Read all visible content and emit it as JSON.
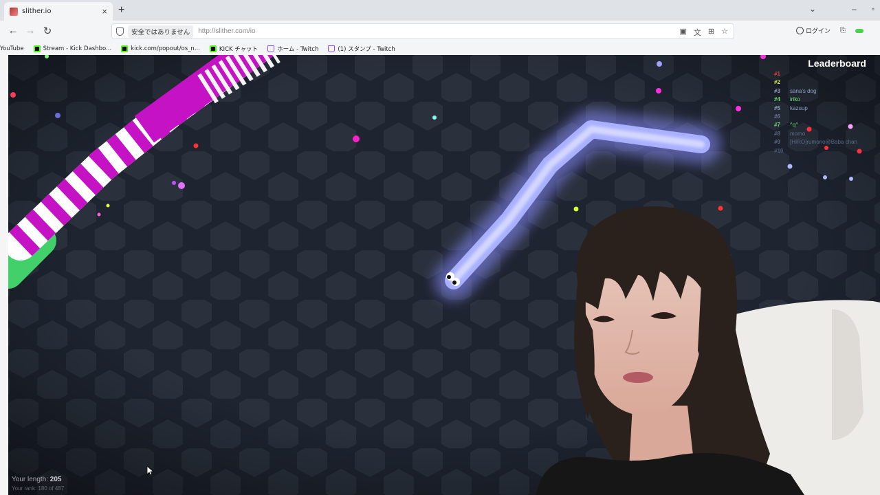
{
  "browser": {
    "tab_title": "slither.io",
    "new_tab": "+",
    "close_tab": "×",
    "insecure_label": "安全ではありません",
    "url": "http://slither.com/io",
    "login_label": "ログイン",
    "bookmarks": [
      {
        "label": "YouTube",
        "icon": "none"
      },
      {
        "label": "Stream - Kick Dashbo...",
        "icon": "kick"
      },
      {
        "label": "kick.com/popout/os_n...",
        "icon": "kick"
      },
      {
        "label": "KICK チャット",
        "icon": "kick"
      },
      {
        "label": "ホーム - Twitch",
        "icon": "twitch"
      },
      {
        "label": "(1) スタンプ - Twitch",
        "icon": "twitch"
      }
    ]
  },
  "game": {
    "leaderboard_title": "Leaderboard",
    "leaderboard": [
      {
        "rank": "#1",
        "name": "",
        "color": "#e04040"
      },
      {
        "rank": "#2",
        "name": "",
        "color": "#d4e84a"
      },
      {
        "rank": "#3",
        "name": "sana's dog",
        "color": "#8fa0c8"
      },
      {
        "rank": "#4",
        "name": "iriko",
        "color": "#6ee06e"
      },
      {
        "rank": "#5",
        "name": "kazuup",
        "color": "#8fa0c8"
      },
      {
        "rank": "#6",
        "name": "",
        "color": "#6a7a98"
      },
      {
        "rank": "#7",
        "name": "^q^",
        "color": "#7ad07a"
      },
      {
        "rank": "#8",
        "name": "momo",
        "color": "#5a6a88"
      },
      {
        "rank": "#9",
        "name": "[HIRO]rumono@Baba chan",
        "color": "#5a6a88"
      },
      {
        "rank": "#10",
        "name": "",
        "color": "#4a5a78"
      }
    ],
    "your_length_label": "Your length:",
    "your_length_value": "205",
    "your_rank_text": "Your rank: 180 of 487"
  },
  "colors": {
    "background": "#1e2430",
    "hex_tile": "#2a313d",
    "player_snake": "#a9b1ff",
    "enemy_snake_a": "#c412c4",
    "enemy_snake_b": "#ffffff"
  }
}
